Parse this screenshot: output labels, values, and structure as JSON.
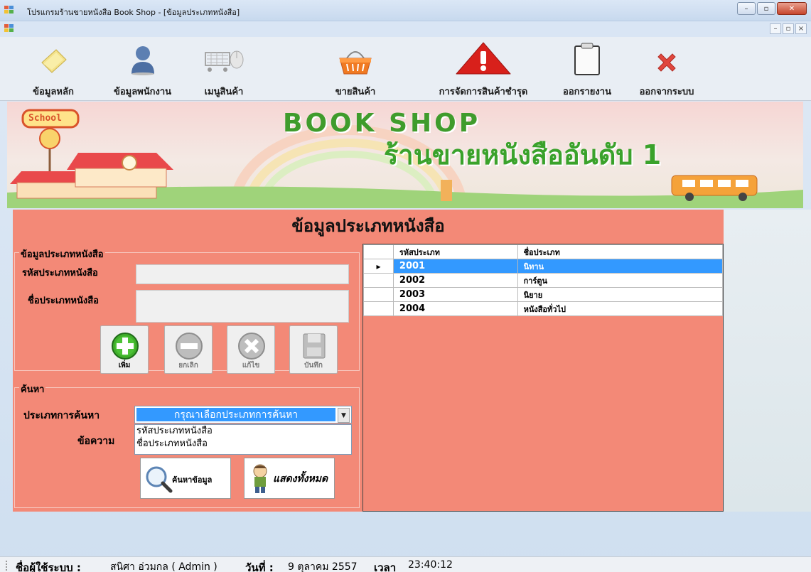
{
  "window": {
    "title": "โปรแกรมร้านขายหนังสือ Book Shop - [ข้อมูลประเภทหนังสือ]",
    "minimize": "–",
    "maximize": "▫",
    "close": "✕",
    "child_minimize": "–",
    "child_restore": "▫",
    "child_close": "×"
  },
  "toolbar": {
    "items": [
      {
        "label": "ข้อมูลหลัก",
        "icon": "notepad-icon"
      },
      {
        "label": "ข้อมูลพนักงาน",
        "icon": "person-icon"
      },
      {
        "label": "เมนูสินค้า",
        "icon": "shopping-cart-icon"
      },
      {
        "label": "ขายสินค้า",
        "icon": "basket-icon"
      },
      {
        "label": "การจัดการสินค้าชำรุด",
        "icon": "warning-icon"
      },
      {
        "label": "ออกรายงาน",
        "icon": "clipboard-icon"
      },
      {
        "label": "ออกจากระบบ",
        "icon": "red-x-icon"
      }
    ]
  },
  "banner": {
    "school_sign": "School",
    "title": "BOOK SHOP",
    "subtitle": "ร้านขายหนังสืออันดับ 1"
  },
  "form": {
    "title": "ข้อมูลประเภทหนังสือ",
    "info_group": {
      "legend": "ข้อมูลประเภทหนังสือ",
      "code_label": "รหัสประเภทหนังสือ",
      "code_value": "",
      "name_label": "ชื่อประเภทหนังสือ",
      "name_value": ""
    },
    "buttons": {
      "add": "เพิ่ม",
      "cancel": "ยกเลิก",
      "edit": "แก้ไข",
      "save": "บันทึก"
    },
    "search_group": {
      "legend": "ค้นหา",
      "type_label": "ประเภทการค้นหา",
      "type_selected": "กรุณาเลือกประเภทการค้นหา",
      "type_options": [
        "รหัสประเภทหนังสือ",
        "ชื่อประเภทหนังสือ"
      ],
      "text_label": "ข้อความ",
      "search_button": "ค้นหาข้อมูล",
      "show_all_button": "แสดงทั้งหมด"
    }
  },
  "grid": {
    "columns": [
      "รหัสประเภท",
      "ชื่อประเภท"
    ],
    "rows": [
      {
        "code": "2001",
        "name": "นิทาน",
        "selected": true
      },
      {
        "code": "2002",
        "name": "การ์ตูน",
        "selected": false
      },
      {
        "code": "2003",
        "name": "นิยาย",
        "selected": false
      },
      {
        "code": "2004",
        "name": "หนังสือทั่วไป",
        "selected": false
      }
    ],
    "row_marker": "▸"
  },
  "status": {
    "user_label": "ชื่อผู้ใช้ระบบ :",
    "user_value": "สนิศา อ่วมกล ( Admin )",
    "date_label": "วันที่ :",
    "date_value": "9 ตุลาคม 2557",
    "time_label": "เวลา",
    "time_value": "23:40:12"
  },
  "colors": {
    "panel": "#f38977",
    "selection": "#3399ff",
    "banner_text": "#3f9c2c"
  }
}
